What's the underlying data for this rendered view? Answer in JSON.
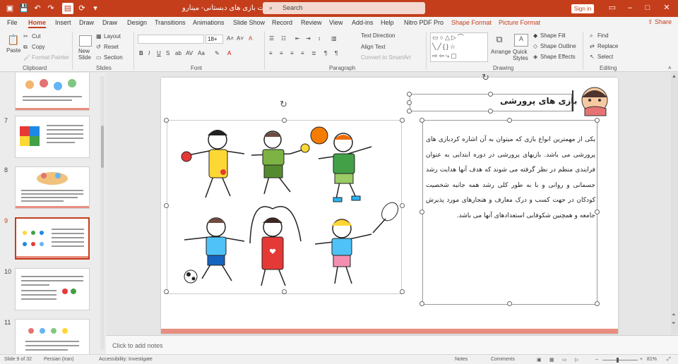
{
  "titlebar": {
    "doc_title": "پاورپوینت بازی های دبستانی- مینارو  -  PowerPoint",
    "search_placeholder": "Search",
    "signin": "Sign in",
    "color": "#c43e1c"
  },
  "tabs": [
    "File",
    "Home",
    "Insert",
    "Draw",
    "Draw",
    "Design",
    "Transitions",
    "Animations",
    "Slide Show",
    "Record",
    "Review",
    "View",
    "Add-ins",
    "Help",
    "Nitro PDF Pro",
    "Shape Format",
    "Picture Format"
  ],
  "share": "Share",
  "ribbon": {
    "clipboard": {
      "label": "Clipboard",
      "paste": "Paste",
      "cut": "Cut",
      "copy": "Copy",
      "format_painter": "Format Painter"
    },
    "slides": {
      "label": "Slides",
      "new_slide": "New Slide",
      "layout": "Layout",
      "reset": "Reset",
      "section": "Section"
    },
    "font": {
      "label": "Font",
      "size": "18+"
    },
    "paragraph": {
      "label": "Paragraph",
      "text_direction": "Text Direction",
      "align_text": "Align Text",
      "convert": "Convert to SmartArt"
    },
    "drawing": {
      "label": "Drawing",
      "arrange": "Arrange",
      "quick_styles": "Quick Styles",
      "shape_fill": "Shape Fill",
      "shape_outline": "Shape Outline",
      "shape_effects": "Shape Effects"
    },
    "editing": {
      "label": "Editing",
      "find": "Find",
      "replace": "Replace",
      "select": "Select"
    }
  },
  "thumbnails": [
    {
      "num": "",
      "selected": false
    },
    {
      "num": "7",
      "selected": false
    },
    {
      "num": "8",
      "selected": false
    },
    {
      "num": "9",
      "selected": true
    },
    {
      "num": "10",
      "selected": false
    },
    {
      "num": "11",
      "selected": false
    }
  ],
  "slide": {
    "title": "بازی های پرورشی",
    "body": "یکی از مهمترین انواع بازی که میتوان به آن اشاره کردبازی های پرورشی می باشد. بازیهای پرورشی در دوره ابتدایی به عنوان فرایندی منظم در نظر گرفته می شوند که هدف آنها هدایت رشد جسمانی و روانی و با به طور کلی رشد همه جانبه شخصیت کودکان در جهت کسب و درک معارف و هنجارهای مورد پذیرش جامعه و همچنین شکوفایی استعدادهای آنها می باشد.",
    "accent": "#e88e80"
  },
  "notes_placeholder": "Click to add notes",
  "status": {
    "slide": "Slide 9 of 32",
    "language": "Persian (Iran)",
    "accessibility": "Accessibility: Investigate",
    "notes": "Notes",
    "comments": "Comments",
    "zoom": "81%"
  }
}
